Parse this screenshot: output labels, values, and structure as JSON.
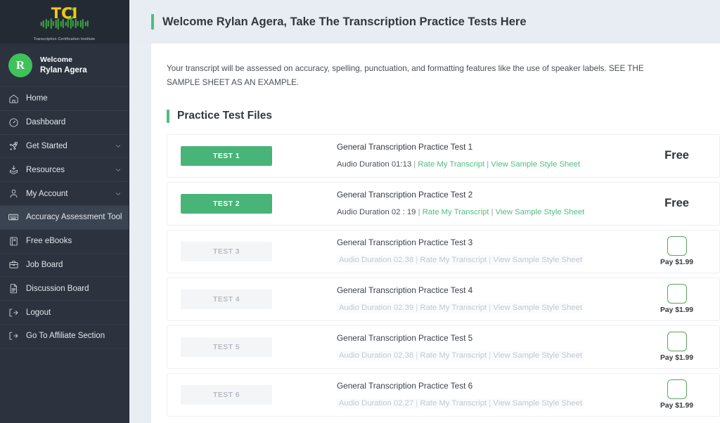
{
  "brand": {
    "logo_text": "TCI",
    "logo_subtitle": "Transcription Certification Institute",
    "accent_green": "#4fbe7e",
    "logo_yellow": "#f5c518",
    "logo_green": "#3fa845",
    "sidebar_bg": "#2c333f"
  },
  "user": {
    "avatar_initial": "R",
    "welcome_label": "Welcome",
    "name": "Rylan Agera"
  },
  "sidebar": {
    "items": [
      {
        "label": "Home",
        "icon": "home-icon",
        "has_chevron": false,
        "active": false
      },
      {
        "label": "Dashboard",
        "icon": "gauge-icon",
        "has_chevron": false,
        "active": false
      },
      {
        "label": "Get Started",
        "icon": "rocket-icon",
        "has_chevron": true,
        "active": false
      },
      {
        "label": "Resources",
        "icon": "download-box-icon",
        "has_chevron": true,
        "active": false
      },
      {
        "label": "My Account",
        "icon": "user-icon",
        "has_chevron": true,
        "active": false
      },
      {
        "label": "Accuracy Assessment Tool",
        "icon": "keyboard-icon",
        "has_chevron": false,
        "active": true
      },
      {
        "label": "Free eBooks",
        "icon": "book-icon",
        "has_chevron": false,
        "active": false
      },
      {
        "label": "Job Board",
        "icon": "briefcase-icon",
        "has_chevron": false,
        "active": false
      },
      {
        "label": "Discussion Board",
        "icon": "document-icon",
        "has_chevron": false,
        "active": false
      },
      {
        "label": "Logout",
        "icon": "logout-icon",
        "has_chevron": false,
        "active": false
      },
      {
        "label": "Go To Affiliate Section",
        "icon": "logout-icon",
        "has_chevron": false,
        "active": false
      }
    ]
  },
  "header": {
    "title": "Welcome Rylan Agera, Take The Transcription Practice Tests Here"
  },
  "main": {
    "intro": "Your transcript will be assessed on accuracy, spelling, punctuation, and formatting features like the use of speaker labels. SEE THE SAMPLE SHEET AS AN EXAMPLE.",
    "section_title": "Practice Test Files",
    "link_rate": "Rate My Transcript",
    "link_style_sheet": "View Sample Style Sheet",
    "separator": "|",
    "tests": [
      {
        "button_label": "TEST 1",
        "name": "General Transcription Practice Test 1",
        "duration": "Audio Duration 01:13",
        "price": "Free",
        "locked": false
      },
      {
        "button_label": "TEST 2",
        "name": "General Transcription Practice Test 2",
        "duration": "Audio Duration 02 : 19",
        "price": "Free",
        "locked": false
      },
      {
        "button_label": "TEST 3",
        "name": "General Transcription Practice Test 3",
        "duration": "Audio Duration 02.38",
        "price": "Pay $1.99",
        "locked": true
      },
      {
        "button_label": "TEST 4",
        "name": "General Transcription Practice Test 4",
        "duration": "Audio Duration 02.39",
        "price": "Pay $1.99",
        "locked": true
      },
      {
        "button_label": "TEST 5",
        "name": "General Transcription Practice Test 5",
        "duration": "Audio Duration 02.38",
        "price": "Pay $1.99",
        "locked": true
      },
      {
        "button_label": "TEST 6",
        "name": "General Transcription Practice Test 6",
        "duration": "Audio Duration 02.27",
        "price": "Pay $1.99",
        "locked": true
      }
    ]
  }
}
